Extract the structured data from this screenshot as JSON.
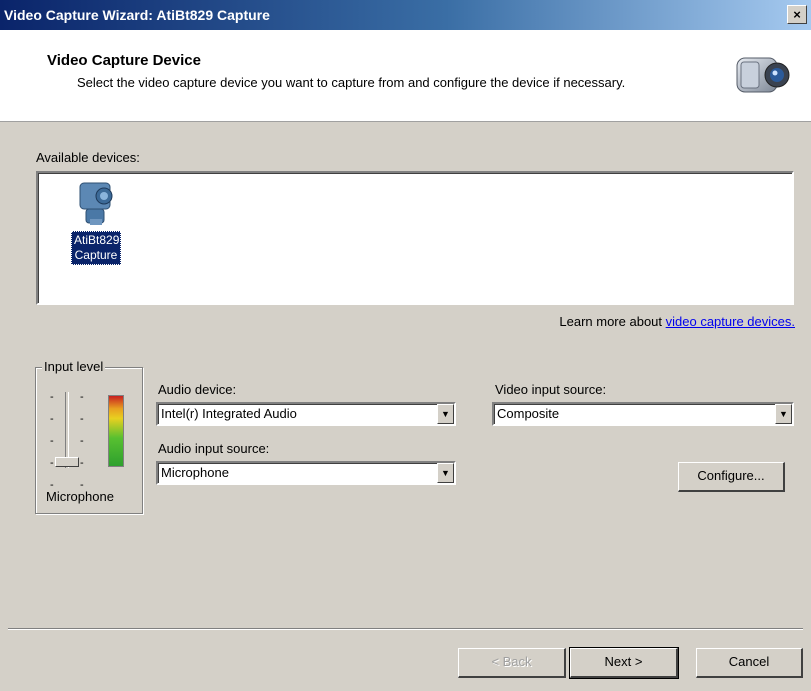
{
  "window": {
    "title": "Video Capture Wizard: AtiBt829 Capture",
    "close_glyph": "×"
  },
  "header": {
    "title": "Video Capture Device",
    "subtitle": "Select the video capture device you want to capture from and configure the device if necessary.",
    "icon": "video-camera-icon"
  },
  "devices": {
    "label": "Available devices:",
    "items": [
      {
        "label": "AtiBt829 Capture",
        "icon": "capture-device-icon",
        "selected": true
      }
    ]
  },
  "learn_more": {
    "prefix": "Learn more about",
    "link_text": "video capture devices."
  },
  "input_level": {
    "legend": "Input level",
    "source_label": "Microphone"
  },
  "audio_device": {
    "label": "Audio device:",
    "value": "Intel(r) Integrated Audio"
  },
  "audio_input_source": {
    "label": "Audio input source:",
    "value": "Microphone"
  },
  "video_input_source": {
    "label": "Video input source:",
    "value": "Composite"
  },
  "buttons": {
    "configure": "Configure...",
    "back": "< Back",
    "next": "Next >",
    "cancel": "Cancel"
  },
  "colors": {
    "title_bar": "#0a246a",
    "selection": "#0a246a",
    "link": "#0000ee",
    "dialog_bg": "#d4d0c8"
  }
}
